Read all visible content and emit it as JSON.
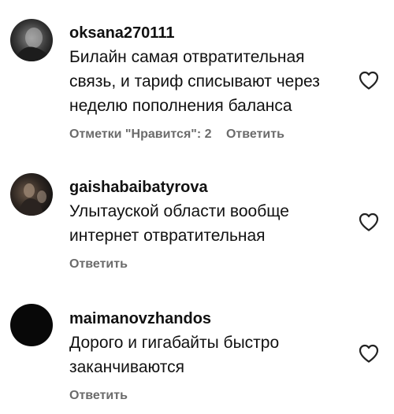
{
  "comments": [
    {
      "username": "oksana270111",
      "text": "Билайн самая отвратительная связь, и тариф списывают через неделю пополнения баланса",
      "likes_label": "Отметки \"Нравится\": 2",
      "reply_label": "Ответить",
      "avatar_icon": "user-avatar-photo",
      "like_icon": "heart-outline-icon"
    },
    {
      "username": "gaishabaibatyrova",
      "text": "Улытауской области вообще интернет отвратительная",
      "reply_label": "Ответить",
      "avatar_icon": "user-avatar-photo",
      "like_icon": "heart-outline-icon"
    },
    {
      "username": "maimanovzhandos",
      "text": "Дорого и гигабайты быстро заканчиваются",
      "reply_label": "Ответить",
      "avatar_icon": "user-avatar-black",
      "like_icon": "heart-outline-icon"
    }
  ],
  "colors": {
    "text": "#111111",
    "secondary_text": "#6b6b6b",
    "background": "#ffffff"
  }
}
